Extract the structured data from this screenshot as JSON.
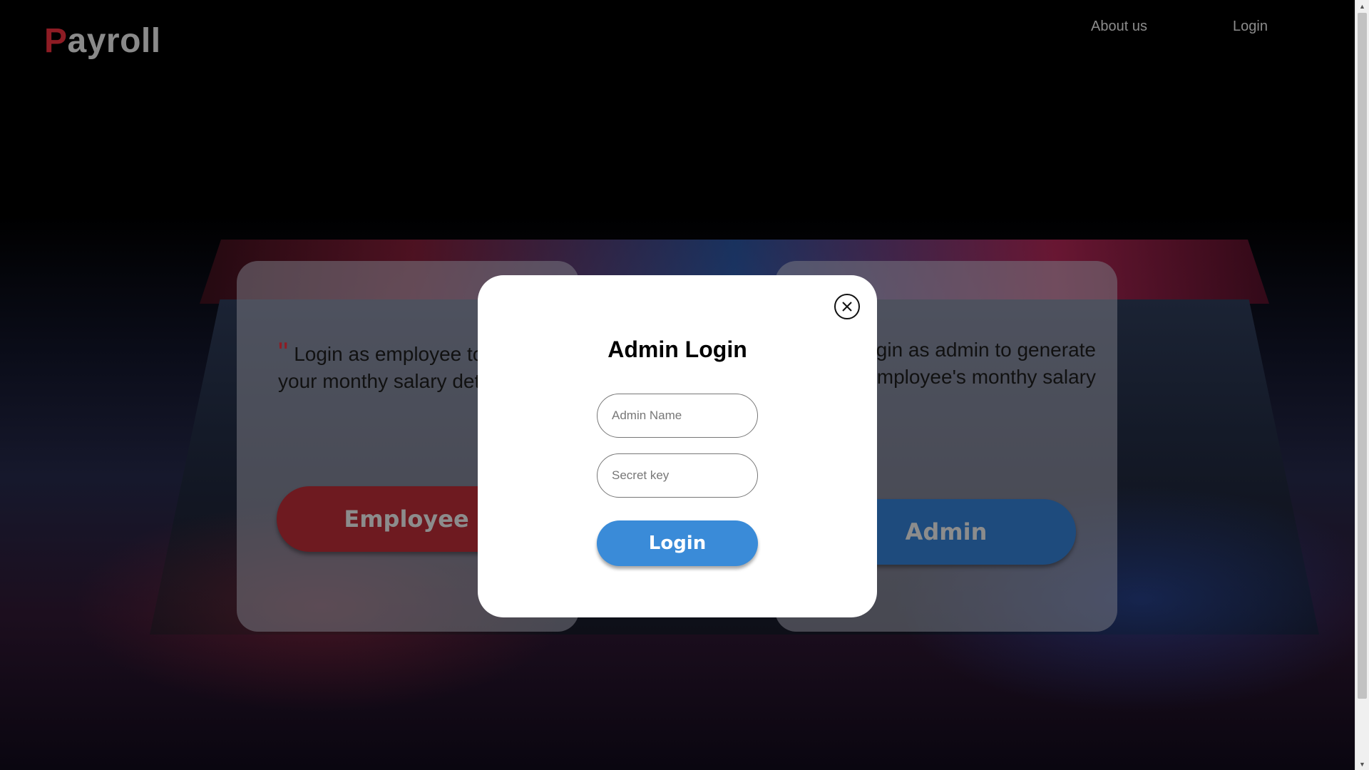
{
  "header": {
    "logo_first_letter": "P",
    "logo_rest": "ayroll",
    "nav": {
      "about": "About us",
      "login": "Login"
    }
  },
  "employee_card": {
    "quote_mark": "\"",
    "text": "Login as employee to view your monthy salary details",
    "button": "Employee"
  },
  "admin_card": {
    "text": "Login as admin to generate employee's monthy salary",
    "button": "Admin"
  },
  "modal": {
    "title": "Admin Login",
    "name_placeholder": "Admin Name",
    "name_value": "",
    "key_placeholder": "Secret key",
    "key_value": "",
    "login_label": "Login",
    "close_icon": "close-circle-icon"
  },
  "colors": {
    "brand_red": "#8e1c24",
    "primary_blue": "#3a8bd8",
    "admin_blue": "#1e4b7d",
    "employee_red": "#6e1a20"
  }
}
